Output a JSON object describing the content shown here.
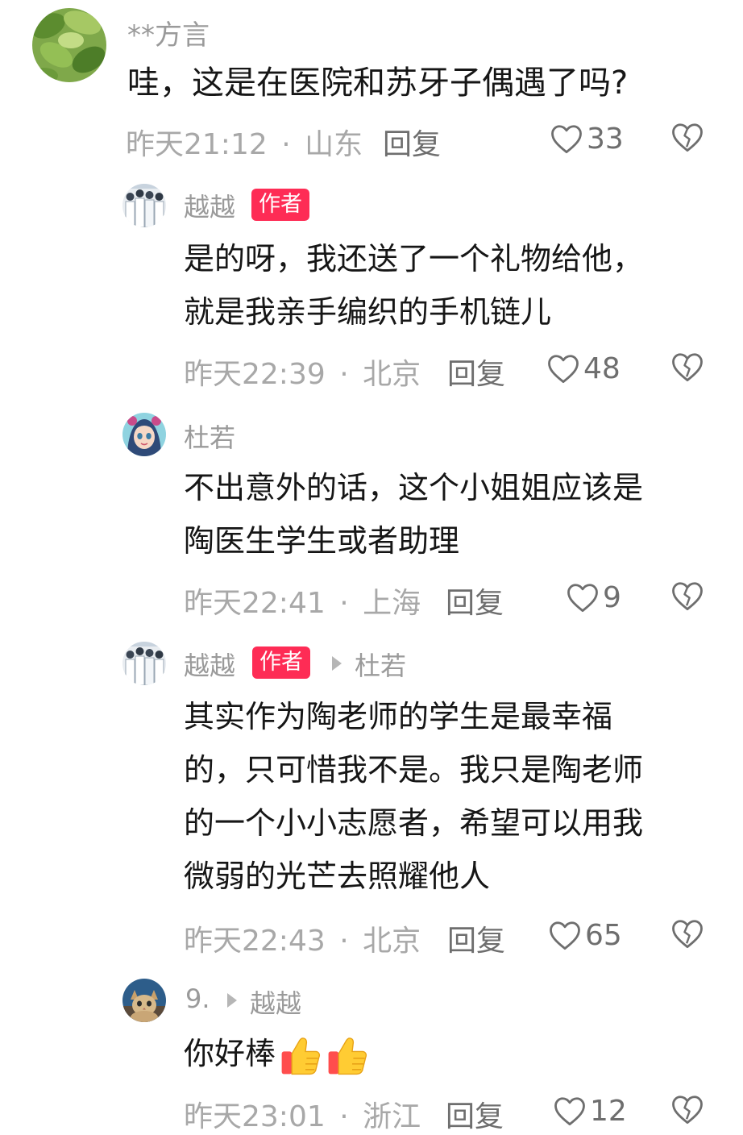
{
  "comments": [
    {
      "username": "**方言",
      "text": "哇，这是在医院和苏牙子偶遇了吗?",
      "time": "昨天21:12",
      "separator": "·",
      "location": "山东",
      "reply_label": "回复",
      "likes": "33",
      "avatar_icon": "green-leaves-avatar"
    },
    {
      "username": "越越",
      "badge": "作者",
      "text_lines": [
        "是的呀，我还送了一个礼物给他，",
        "就是我亲手编织的手机链儿"
      ],
      "time": "昨天22:39",
      "separator": "·",
      "location": "北京",
      "reply_label": "回复",
      "likes": "48",
      "avatar_icon": "doctors-group-avatar"
    },
    {
      "username": "杜若",
      "text_lines": [
        "不出意外的话，这个小姐姐应该是",
        "陶医生学生或者助理"
      ],
      "time": "昨天22:41",
      "separator": "·",
      "location": "上海",
      "reply_label": "回复",
      "likes": "9",
      "avatar_icon": "cartoon-girl-avatar"
    },
    {
      "username": "越越",
      "badge": "作者",
      "reply_to": "杜若",
      "text_lines": [
        "其实作为陶老师的学生是最幸福",
        "的，只可惜我不是。我只是陶老师",
        "的一个小小志愿者，希望可以用我",
        "微弱的光芒去照耀他人"
      ],
      "time": "昨天22:43",
      "separator": "·",
      "location": "北京",
      "reply_label": "回复",
      "likes": "65",
      "avatar_icon": "doctors-group-avatar"
    },
    {
      "username": "9.",
      "reply_to": "越越",
      "text": "你好棒",
      "emojis": [
        "thumbs-up-emoji",
        "thumbs-up-emoji"
      ],
      "time": "昨天23:01",
      "separator": "·",
      "location": "浙江",
      "reply_label": "回复",
      "likes": "12",
      "avatar_icon": "cat-avatar"
    }
  ],
  "colors": {
    "text_primary": "#161616",
    "text_secondary": "#9a9a9a",
    "author_badge": "#fe2c55",
    "icon_gray": "#6e6e6e"
  }
}
